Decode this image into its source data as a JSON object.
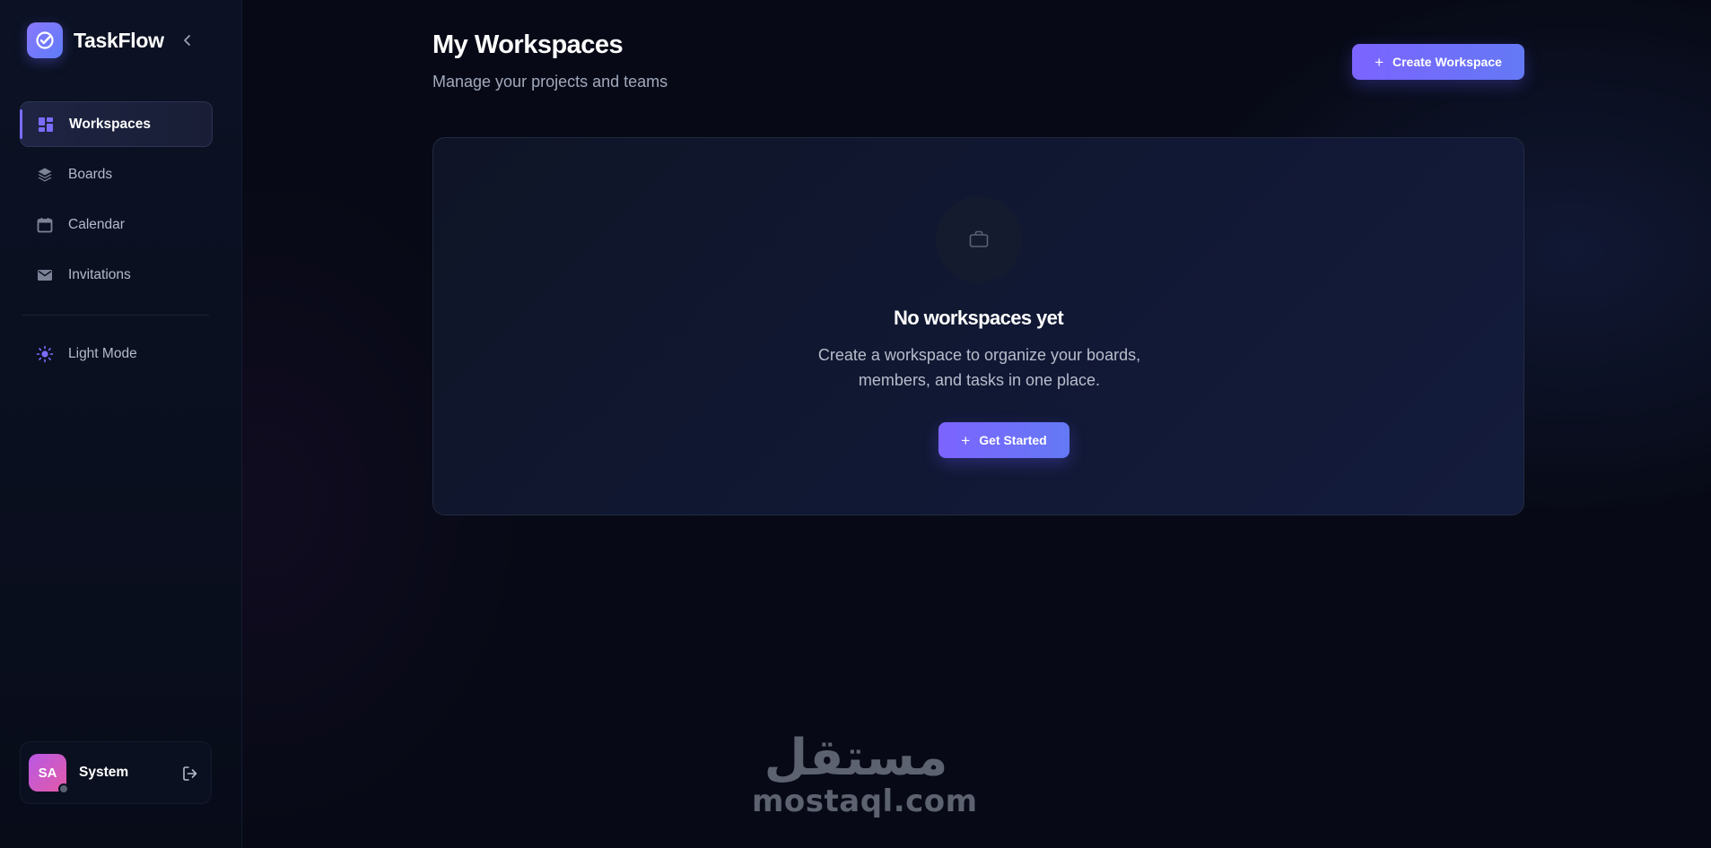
{
  "brand": {
    "name": "TaskFlow",
    "logo_icon": "check-circle-icon",
    "accent": "#7c64ff"
  },
  "sidebar": {
    "collapse_icon": "chevron-left-icon",
    "items": [
      {
        "label": "Workspaces",
        "icon": "grid-icon",
        "active": true
      },
      {
        "label": "Boards",
        "icon": "layers-icon",
        "active": false
      },
      {
        "label": "Calendar",
        "icon": "calendar-icon",
        "active": false
      },
      {
        "label": "Invitations",
        "icon": "mail-icon",
        "active": false
      }
    ],
    "theme_toggle": {
      "label": "Light Mode",
      "icon": "sun-icon"
    },
    "user": {
      "initials": "SA",
      "name": "System",
      "logout_icon": "logout-icon"
    }
  },
  "header": {
    "title": "My Workspaces",
    "subtitle": "Manage your projects and teams",
    "create_button": "Create Workspace"
  },
  "empty_state": {
    "icon": "briefcase-icon",
    "title": "No workspaces yet",
    "description": "Create a workspace to organize your boards, members, and tasks in one place.",
    "button": "Get Started"
  },
  "watermark": {
    "arabic": "مستقل",
    "latin": "mostaql.com"
  }
}
